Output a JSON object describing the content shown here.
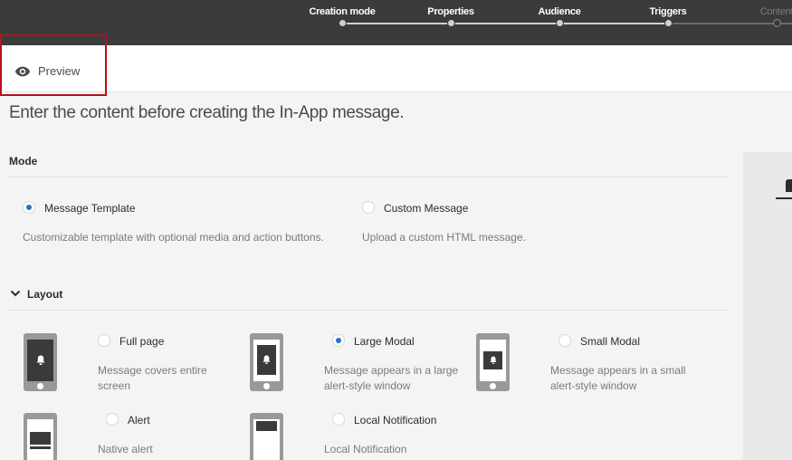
{
  "steps": [
    {
      "label": "Creation mode"
    },
    {
      "label": "Properties"
    },
    {
      "label": "Audience"
    },
    {
      "label": "Triggers"
    },
    {
      "label": "Content"
    }
  ],
  "preview": {
    "label": "Preview",
    "icon": "eye-icon"
  },
  "intro": "Enter the content before creating the In-App message.",
  "mode": {
    "title": "Mode",
    "options": [
      {
        "label": "Message Template",
        "desc": "Customizable template with optional media and action buttons.",
        "checked": true
      },
      {
        "label": "Custom Message",
        "desc": "Upload a custom HTML message.",
        "checked": false
      }
    ]
  },
  "layout": {
    "title": "Layout",
    "options": [
      {
        "label": "Full page",
        "desc": "Message covers entire screen",
        "checked": false
      },
      {
        "label": "Large Modal",
        "desc": "Message appears in a large alert-style window",
        "checked": true
      },
      {
        "label": "Small Modal",
        "desc": "Message appears in a small alert-style window",
        "checked": false
      },
      {
        "label": "Alert",
        "desc": "Native alert",
        "checked": false
      },
      {
        "label": "Local Notification",
        "desc": "Local Notification",
        "checked": false
      }
    ]
  },
  "colors": {
    "accent": "#2d6cc7",
    "highlight": "#b5121b",
    "topbar": "#3b3b3b"
  }
}
